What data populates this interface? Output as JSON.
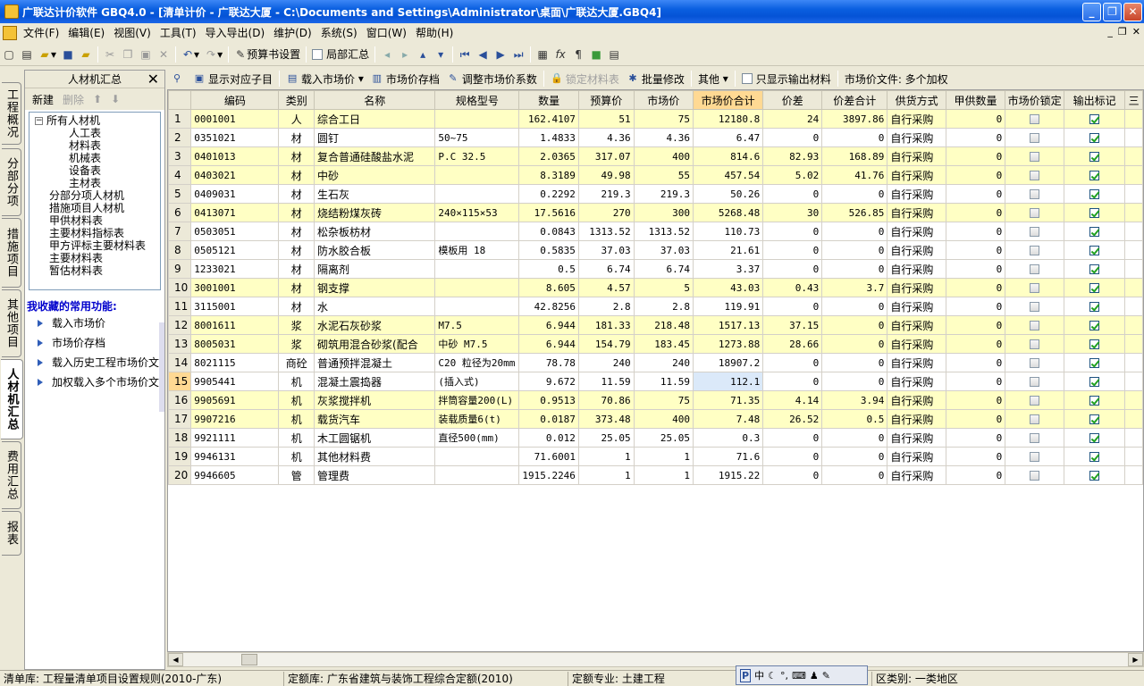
{
  "window": {
    "title": "广联达计价软件 GBQ4.0 - [清单计价 - 广联达大厦 - C:\\Documents and Settings\\Administrator\\桌面\\广联达大厦.GBQ4]"
  },
  "menu": [
    "文件(F)",
    "编辑(E)",
    "视图(V)",
    "工具(T)",
    "导入导出(D)",
    "维护(D)",
    "系统(S)",
    "窗口(W)",
    "帮助(H)"
  ],
  "toolbar": {
    "budget_setting": "预算书设置",
    "part_summary": "局部汇总"
  },
  "vtabs": [
    "工程概况",
    "分部分项",
    "措施项目",
    "其他项目",
    "人材机汇总",
    "费用汇总",
    "报表"
  ],
  "left_panel": {
    "title": "人材机汇总",
    "new_label": "新建",
    "delete_label": "删除",
    "tree_root": "所有人材机",
    "tree_children": [
      "人工表",
      "材料表",
      "机械表",
      "设备表",
      "主材表"
    ],
    "tree_others": [
      "分部分项人材机",
      "措施项目人材机",
      "甲供材料表",
      "主要材料指标表",
      "甲方评标主要材料表",
      "主要材料表",
      "暂估材料表"
    ],
    "fav_title": "我收藏的常用功能:",
    "fav_items": [
      "载入市场价",
      "市场价存档",
      "载入历史工程市场价文件",
      "加权载入多个市场价文件"
    ]
  },
  "main_toolbar": {
    "show_sub": "显示对应子目",
    "load_price": "载入市场价",
    "save_price": "市场价存档",
    "adjust_coef": "调整市场价系数",
    "lock_table": "锁定材料表",
    "batch_edit": "批量修改",
    "other": "其他",
    "only_output": "只显示输出材料",
    "price_file": "市场价文件: 多个加权"
  },
  "table": {
    "columns": [
      "编码",
      "类别",
      "名称",
      "规格型号",
      "数量",
      "预算价",
      "市场价",
      "市场价合计",
      "价差",
      "价差合计",
      "供货方式",
      "甲供数量",
      "市场价锁定",
      "输出标记",
      "三"
    ],
    "rows": [
      {
        "n": "1",
        "code": "0001001",
        "type": "人",
        "name": "综合工日",
        "spec": "",
        "qty": "162.4107",
        "bp": "51",
        "mp": "75",
        "mt": "12180.8",
        "d": "24",
        "dt": "3897.86",
        "supply": "自行采购",
        "jq": "0",
        "lock": false,
        "out": true
      },
      {
        "n": "2",
        "code": "0351021",
        "type": "材",
        "name": "圆钉",
        "spec": "50~75",
        "qty": "1.4833",
        "bp": "4.36",
        "mp": "4.36",
        "mt": "6.47",
        "d": "0",
        "dt": "0",
        "supply": "自行采购",
        "jq": "0",
        "lock": false,
        "out": true
      },
      {
        "n": "3",
        "code": "0401013",
        "type": "材",
        "name": "复合普通硅酸盐水泥",
        "spec": "P.C 32.5",
        "qty": "2.0365",
        "bp": "317.07",
        "mp": "400",
        "mt": "814.6",
        "d": "82.93",
        "dt": "168.89",
        "supply": "自行采购",
        "jq": "0",
        "lock": false,
        "out": true
      },
      {
        "n": "4",
        "code": "0403021",
        "type": "材",
        "name": "中砂",
        "spec": "",
        "qty": "8.3189",
        "bp": "49.98",
        "mp": "55",
        "mt": "457.54",
        "d": "5.02",
        "dt": "41.76",
        "supply": "自行采购",
        "jq": "0",
        "lock": false,
        "out": true
      },
      {
        "n": "5",
        "code": "0409031",
        "type": "材",
        "name": "生石灰",
        "spec": "",
        "qty": "0.2292",
        "bp": "219.3",
        "mp": "219.3",
        "mt": "50.26",
        "d": "0",
        "dt": "0",
        "supply": "自行采购",
        "jq": "0",
        "lock": false,
        "out": true
      },
      {
        "n": "6",
        "code": "0413071",
        "type": "材",
        "name": "烧结粉煤灰砖",
        "spec": "240×115×53",
        "qty": "17.5616",
        "bp": "270",
        "mp": "300",
        "mt": "5268.48",
        "d": "30",
        "dt": "526.85",
        "supply": "自行采购",
        "jq": "0",
        "lock": false,
        "out": true
      },
      {
        "n": "7",
        "code": "0503051",
        "type": "材",
        "name": "松杂板枋材",
        "spec": "",
        "qty": "0.0843",
        "bp": "1313.52",
        "mp": "1313.52",
        "mt": "110.73",
        "d": "0",
        "dt": "0",
        "supply": "自行采购",
        "jq": "0",
        "lock": false,
        "out": true
      },
      {
        "n": "8",
        "code": "0505121",
        "type": "材",
        "name": "防水胶合板",
        "spec": "模板用 18",
        "qty": "0.5835",
        "bp": "37.03",
        "mp": "37.03",
        "mt": "21.61",
        "d": "0",
        "dt": "0",
        "supply": "自行采购",
        "jq": "0",
        "lock": false,
        "out": true
      },
      {
        "n": "9",
        "code": "1233021",
        "type": "材",
        "name": "隔离剂",
        "spec": "",
        "qty": "0.5",
        "bp": "6.74",
        "mp": "6.74",
        "mt": "3.37",
        "d": "0",
        "dt": "0",
        "supply": "自行采购",
        "jq": "0",
        "lock": false,
        "out": true
      },
      {
        "n": "10",
        "code": "3001001",
        "type": "材",
        "name": "钢支撑",
        "spec": "",
        "qty": "8.605",
        "bp": "4.57",
        "mp": "5",
        "mt": "43.03",
        "d": "0.43",
        "dt": "3.7",
        "supply": "自行采购",
        "jq": "0",
        "lock": false,
        "out": true
      },
      {
        "n": "11",
        "code": "3115001",
        "type": "材",
        "name": "水",
        "spec": "",
        "qty": "42.8256",
        "bp": "2.8",
        "mp": "2.8",
        "mt": "119.91",
        "d": "0",
        "dt": "0",
        "supply": "自行采购",
        "jq": "0",
        "lock": false,
        "out": true
      },
      {
        "n": "12",
        "code": "8001611",
        "type": "浆",
        "name": "水泥石灰砂浆",
        "spec": "M7.5",
        "qty": "6.944",
        "bp": "181.33",
        "mp": "218.48",
        "mt": "1517.13",
        "d": "37.15",
        "dt": "0",
        "supply": "自行采购",
        "jq": "0",
        "lock": false,
        "out": true
      },
      {
        "n": "13",
        "code": "8005031",
        "type": "浆",
        "name": "砌筑用混合砂浆(配合",
        "spec": "中砂 M7.5",
        "qty": "6.944",
        "bp": "154.79",
        "mp": "183.45",
        "mt": "1273.88",
        "d": "28.66",
        "dt": "0",
        "supply": "自行采购",
        "jq": "0",
        "lock": false,
        "out": true
      },
      {
        "n": "14",
        "code": "8021115",
        "type": "商砼",
        "name": "普通预拌混凝土",
        "spec": "C20 粒径为20mm",
        "qty": "78.78",
        "bp": "240",
        "mp": "240",
        "mt": "18907.2",
        "d": "0",
        "dt": "0",
        "supply": "自行采购",
        "jq": "0",
        "lock": false,
        "out": true
      },
      {
        "n": "15",
        "code": "9905441",
        "type": "机",
        "name": "混凝土震捣器",
        "spec": "(插入式)",
        "qty": "9.672",
        "bp": "11.59",
        "mp": "11.59",
        "mt": "112.1",
        "d": "0",
        "dt": "0",
        "supply": "自行采购",
        "jq": "0",
        "lock": false,
        "out": true
      },
      {
        "n": "16",
        "code": "9905691",
        "type": "机",
        "name": "灰浆搅拌机",
        "spec": "拌筒容量200(L)",
        "qty": "0.9513",
        "bp": "70.86",
        "mp": "75",
        "mt": "71.35",
        "d": "4.14",
        "dt": "3.94",
        "supply": "自行采购",
        "jq": "0",
        "lock": false,
        "out": true
      },
      {
        "n": "17",
        "code": "9907216",
        "type": "机",
        "name": "载货汽车",
        "spec": "装载质量6(t)",
        "qty": "0.0187",
        "bp": "373.48",
        "mp": "400",
        "mt": "7.48",
        "d": "26.52",
        "dt": "0.5",
        "supply": "自行采购",
        "jq": "0",
        "lock": false,
        "out": true
      },
      {
        "n": "18",
        "code": "9921111",
        "type": "机",
        "name": "木工圆锯机",
        "spec": "直径500(mm)",
        "qty": "0.012",
        "bp": "25.05",
        "mp": "25.05",
        "mt": "0.3",
        "d": "0",
        "dt": "0",
        "supply": "自行采购",
        "jq": "0",
        "lock": false,
        "out": true
      },
      {
        "n": "19",
        "code": "9946131",
        "type": "机",
        "name": "其他材料费",
        "spec": "",
        "qty": "71.6001",
        "bp": "1",
        "mp": "1",
        "mt": "71.6",
        "d": "0",
        "dt": "0",
        "supply": "自行采购",
        "jq": "0",
        "lock": false,
        "out": true
      },
      {
        "n": "20",
        "code": "9946605",
        "type": "管",
        "name": "管理费",
        "spec": "",
        "qty": "1915.2246",
        "bp": "1",
        "mp": "1",
        "mt": "1915.22",
        "d": "0",
        "dt": "0",
        "supply": "自行采购",
        "jq": "0",
        "lock": false,
        "out": true
      }
    ]
  },
  "status": {
    "list_lib": "清单库: 工程量清单项目设置规则(2010-广东)",
    "quota_lib": "定额库: 广东省建筑与装饰工程综合定额(2010)",
    "quota_major": "定额专业: 土建工程",
    "region": "区类别: 一类地区",
    "ime_label": "中"
  }
}
